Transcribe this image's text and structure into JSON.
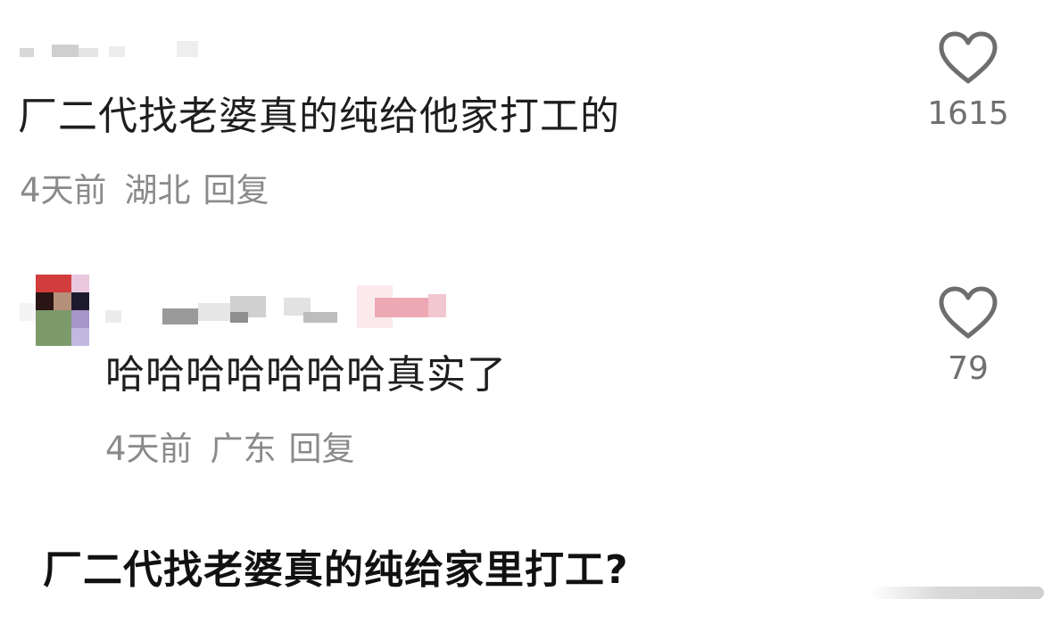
{
  "comments": [
    {
      "text": "厂二代找老婆真的纯给他家打工的",
      "time": "4天前",
      "location": "湖北",
      "reply_label": "回复",
      "likes": "1615",
      "heart_icon": "heart-outline-icon"
    },
    {
      "text": "哈哈哈哈哈哈哈真实了",
      "time": "4天前",
      "location": "广东",
      "reply_label": "回复",
      "likes": "79",
      "heart_icon": "heart-outline-icon"
    }
  ],
  "caption": "厂二代找老婆真的纯给家里打工?",
  "colors": {
    "text": "#1e1e1e",
    "meta": "#8a8a8a",
    "like_count": "#707070",
    "heart_stroke": "#6e6e6e"
  }
}
